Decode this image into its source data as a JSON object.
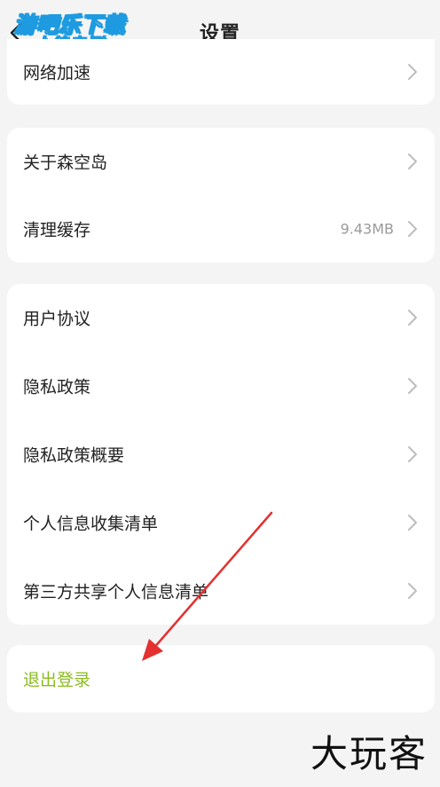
{
  "header": {
    "title": "设置"
  },
  "watermark": {
    "line1": "游吧乐下载",
    "line2": "小编亲测"
  },
  "groups": [
    {
      "items": [
        {
          "label": "网络加速"
        }
      ]
    },
    {
      "items": [
        {
          "label": "关于森空岛"
        },
        {
          "label": "清理缓存",
          "value": "9.43MB"
        }
      ]
    },
    {
      "items": [
        {
          "label": "用户协议"
        },
        {
          "label": "隐私政策"
        },
        {
          "label": "隐私政策概要"
        },
        {
          "label": "个人信息收集清单"
        },
        {
          "label": "第三方共享个人信息清单"
        }
      ]
    }
  ],
  "logout": {
    "label": "退出登录",
    "color": "#8cbc1f"
  },
  "annotation": {
    "arrow_color": "#e53030"
  },
  "footer_brand": "大玩客",
  "icons": {
    "back": "chevron-left-icon",
    "row_arrow": "chevron-right-icon"
  }
}
